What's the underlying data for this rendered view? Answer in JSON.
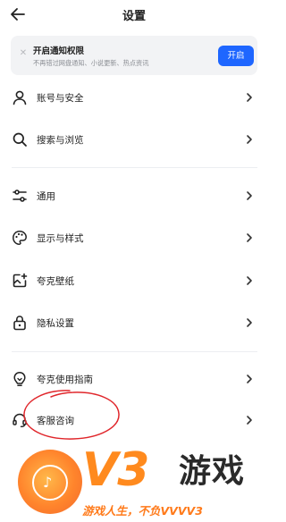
{
  "header": {
    "title": "设置"
  },
  "notification": {
    "title": "开启通知权限",
    "subtitle": "不再错过网盘通知、小说更新、热点资讯",
    "button_label": "开启"
  },
  "menu": {
    "items": [
      {
        "label": "账号与安全",
        "icon": "person-icon"
      },
      {
        "label": "搜索与浏览",
        "icon": "search-icon"
      },
      {
        "label": "通用",
        "icon": "sliders-icon"
      },
      {
        "label": "显示与样式",
        "icon": "palette-icon"
      },
      {
        "label": "夸克壁纸",
        "icon": "wallpaper-icon"
      },
      {
        "label": "隐私设置",
        "icon": "lock-icon"
      },
      {
        "label": "夸克使用指南",
        "icon": "lightbulb-icon"
      },
      {
        "label": "客服咨询",
        "icon": "headset-icon"
      }
    ]
  },
  "watermark": {
    "brand": "V3",
    "brand_suffix": "游戏",
    "slogan": "游戏人生，不负VVVV3"
  },
  "colors": {
    "accent": "#1e66ff",
    "annotation": "#e0262b",
    "watermark_orange": "#ff8a1e"
  }
}
